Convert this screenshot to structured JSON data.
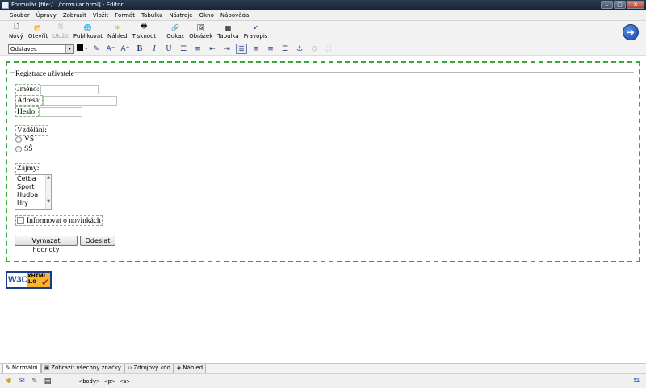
{
  "window": {
    "title": "Formulář [file:/.../formular.html] - Editor",
    "min": "–",
    "max": "□",
    "close": "✕"
  },
  "menu": [
    "Soubor",
    "Úpravy",
    "Zobrazit",
    "Vložit",
    "Formát",
    "Tabulka",
    "Nástroje",
    "Okno",
    "Nápověda"
  ],
  "toolbar": {
    "buttons": [
      {
        "label": "Nový",
        "icon": "new-document-icon",
        "glyph": "🗋",
        "disabled": false
      },
      {
        "label": "Otevřít",
        "icon": "open-folder-icon",
        "glyph": "📂",
        "disabled": false
      },
      {
        "label": "Uložit",
        "icon": "save-icon",
        "glyph": "🖫",
        "disabled": true
      },
      {
        "label": "Publikovat",
        "icon": "publish-icon",
        "glyph": "🌐",
        "disabled": false
      },
      {
        "label": "Náhled",
        "icon": "preview-icon",
        "glyph": "✳",
        "disabled": false
      },
      {
        "label": "Tisknout",
        "icon": "print-icon",
        "glyph": "🖶",
        "disabled": false
      },
      {
        "label": "Odkaz",
        "icon": "link-icon",
        "glyph": "🔗",
        "disabled": false
      },
      {
        "label": "Obrázek",
        "icon": "image-icon",
        "glyph": "🖼",
        "disabled": false
      },
      {
        "label": "Tabulka",
        "icon": "table-icon",
        "glyph": "▦",
        "disabled": false
      },
      {
        "label": "Pravopis",
        "icon": "spellcheck-icon",
        "glyph": "✔",
        "disabled": false
      }
    ],
    "help_glyph": "➜"
  },
  "format": {
    "paragraph_style": "Odstavec",
    "dropdown_glyph": "▾",
    "text_color": "#000000",
    "buttons": [
      {
        "name": "highlight-icon",
        "glyph": "✎",
        "active": false,
        "dim": false
      },
      {
        "name": "decrease-font-icon",
        "glyph": "A⁻",
        "active": false,
        "dim": false
      },
      {
        "name": "increase-font-icon",
        "glyph": "A⁺",
        "active": false,
        "dim": false
      },
      {
        "name": "bold-icon",
        "glyph": "B",
        "active": false,
        "dim": false
      },
      {
        "name": "italic-icon",
        "glyph": "I",
        "active": false,
        "dim": false
      },
      {
        "name": "underline-icon",
        "glyph": "U",
        "active": false,
        "dim": false
      },
      {
        "name": "bullet-list-icon",
        "glyph": "☰",
        "active": false,
        "dim": false
      },
      {
        "name": "numbered-list-icon",
        "glyph": "≡",
        "active": false,
        "dim": false
      },
      {
        "name": "outdent-icon",
        "glyph": "⇤",
        "active": false,
        "dim": false
      },
      {
        "name": "indent-icon",
        "glyph": "⇥",
        "active": false,
        "dim": false
      },
      {
        "name": "align-left-icon",
        "glyph": "≣",
        "active": true,
        "dim": false
      },
      {
        "name": "align-center-icon",
        "glyph": "≡",
        "active": false,
        "dim": false
      },
      {
        "name": "align-right-icon",
        "glyph": "≡",
        "active": false,
        "dim": false
      },
      {
        "name": "justify-icon",
        "glyph": "☰",
        "active": false,
        "dim": false
      },
      {
        "name": "anchor-icon",
        "glyph": "⚓",
        "active": false,
        "dim": false
      },
      {
        "name": "background-color-icon",
        "glyph": "⛭",
        "active": false,
        "dim": true
      },
      {
        "name": "remove-format-icon",
        "glyph": "⛶",
        "active": false,
        "dim": true
      }
    ]
  },
  "form": {
    "legend": "Registrace uživatele",
    "name_label": "Jméno:",
    "address_label": "Adresa:",
    "password_label": "Heslo:",
    "education_label": "Vzdělání:",
    "radio_vs": "VŠ",
    "radio_ss": "SŠ",
    "interests_label": "Zájmy:",
    "interests": [
      "Četba",
      "Sport",
      "Hudba",
      "Hry"
    ],
    "scroll_up": "▲",
    "scroll_down": "▼",
    "newsletter_label": "Informovat o novinkách",
    "reset_button": "Vymazat hodnoty",
    "submit_button": "Odeslat"
  },
  "badge": {
    "w3c": "W3C",
    "line1": "XHTML",
    "line2": "1.0",
    "check": "✔"
  },
  "tabs": [
    {
      "label": "Normální",
      "glyph": "✎",
      "active": true
    },
    {
      "label": "Zobrazit všechny značky",
      "glyph": "▣",
      "active": false
    },
    {
      "label": "Zdrojový kód",
      "glyph": "‹›",
      "active": false
    },
    {
      "label": "Náhled",
      "glyph": "◈",
      "active": false
    }
  ],
  "status": {
    "icons": [
      "✱",
      "✉",
      "✎",
      "▤"
    ],
    "path": [
      "<body>",
      "<p>",
      "<a>"
    ],
    "right_glyph": "⇆"
  }
}
